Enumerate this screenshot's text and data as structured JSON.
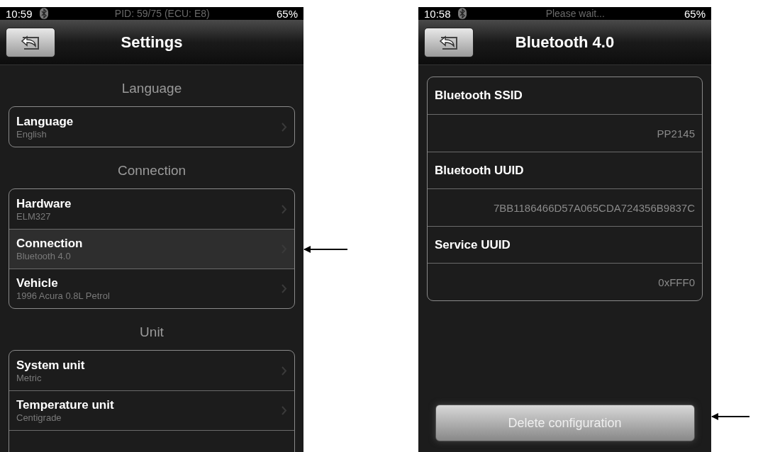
{
  "phones": [
    {
      "status": {
        "time": "10:59",
        "message": "PID: 59/75 (ECU: E8)",
        "battery": "65%"
      },
      "title": "Settings",
      "kind": "list",
      "sections": [
        {
          "header": "Language",
          "rows": [
            {
              "label": "Language",
              "value": "English",
              "selected": false
            }
          ]
        },
        {
          "header": "Connection",
          "rows": [
            {
              "label": "Hardware",
              "value": "ELM327",
              "selected": false
            },
            {
              "label": "Connection",
              "value": "Bluetooth 4.0",
              "selected": true
            },
            {
              "label": "Vehicle",
              "value": "1996 Acura 0.8L Petrol",
              "selected": false
            }
          ]
        },
        {
          "header": "Unit",
          "rows": [
            {
              "label": "System unit",
              "value": "Metric",
              "selected": false
            },
            {
              "label": "Temperature unit",
              "value": "Centigrade",
              "selected": false
            }
          ]
        }
      ]
    },
    {
      "status": {
        "time": "10:58",
        "message": "Please wait...",
        "battery": "65%"
      },
      "title": "Bluetooth 4.0",
      "kind": "detail",
      "fields": [
        {
          "label": "Bluetooth SSID",
          "value": "PP2145"
        },
        {
          "label": "Bluetooth UUID",
          "value": "7BB1186466D57A065CDA724356B9837C"
        },
        {
          "label": "Service UUID",
          "value": "0xFFF0"
        }
      ],
      "action": "Delete configuration"
    }
  ]
}
